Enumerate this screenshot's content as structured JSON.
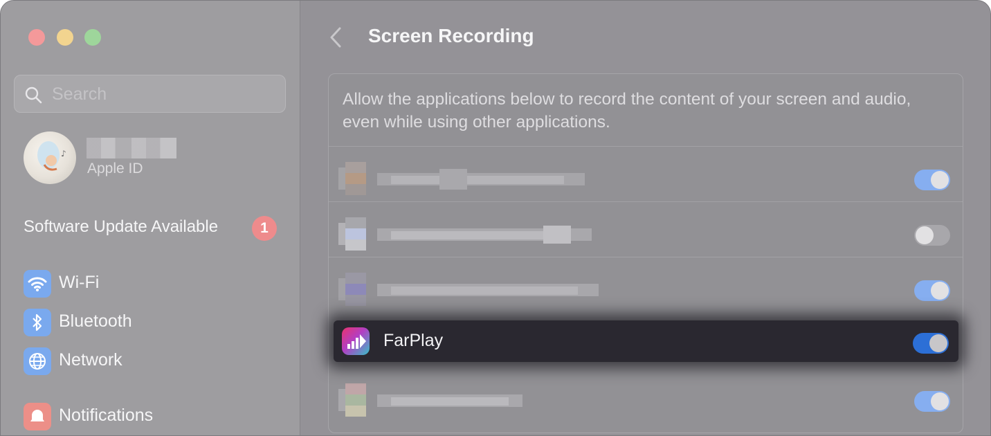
{
  "window": {
    "title": "Screen Recording"
  },
  "sidebar": {
    "search": {
      "placeholder": "Search"
    },
    "account": {
      "subtitle": "Apple ID"
    },
    "software_update": {
      "label": "Software Update Available",
      "badge": "1"
    },
    "items": [
      {
        "label": "Wi-Fi",
        "icon": "wifi-icon"
      },
      {
        "label": "Bluetooth",
        "icon": "bluetooth-icon"
      },
      {
        "label": "Network",
        "icon": "globe-icon"
      },
      {
        "label": "Notifications",
        "icon": "bell-icon"
      }
    ]
  },
  "main": {
    "title": "Screen Recording",
    "description": "Allow the applications below to record the content of your screen and audio, even while using other applications.",
    "apps": [
      {
        "name": "",
        "enabled": true
      },
      {
        "name": "",
        "enabled": false
      },
      {
        "name": "",
        "enabled": true
      },
      {
        "name": "FarPlay",
        "enabled": true
      },
      {
        "name": "",
        "enabled": true
      }
    ]
  },
  "colors": {
    "toggle_on": "#2c6fd6",
    "badge": "#ee8b8c"
  }
}
